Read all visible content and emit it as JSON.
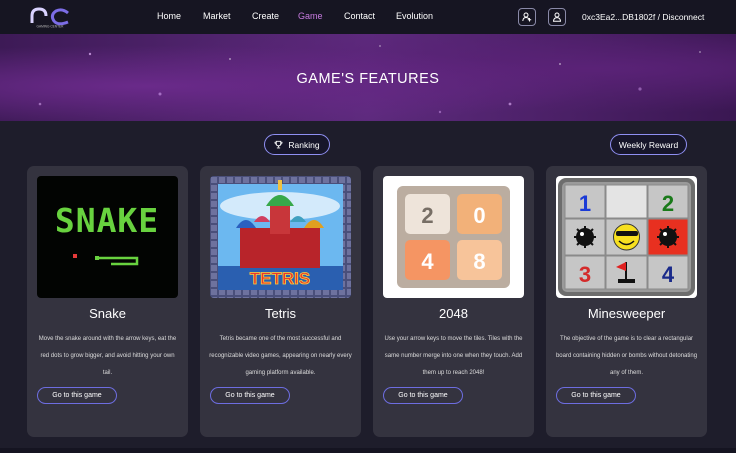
{
  "nav": {
    "logo_text": "GAMING CENTER",
    "links": [
      {
        "label": "Home",
        "active": false
      },
      {
        "label": "Market",
        "active": false
      },
      {
        "label": "Create",
        "active": false
      },
      {
        "label": "Game",
        "active": true
      },
      {
        "label": "Contact",
        "active": false
      },
      {
        "label": "Evolution",
        "active": false
      }
    ],
    "icons": [
      "user-add-icon",
      "user-icon"
    ],
    "wallet_text": "0xc3Ea2...DB1802f / Disconnect"
  },
  "hero": {
    "title": "GAME'S FEATURES"
  },
  "controls": {
    "ranking_label": "Ranking",
    "ranking_icon": "trophy-icon",
    "weekly_label": "Weekly Reward"
  },
  "games": [
    {
      "title": "Snake",
      "description": "Move the snake around with the arrow keys, eat the red dots to grow bigger, and avoid hitting your own tail.",
      "button": "Go to this game",
      "thumb_text": "SNAKE"
    },
    {
      "title": "Tetris",
      "description": "Tetris became one of the most successful and recognizable video games, appearing on nearly every gaming platform available.",
      "button": "Go to this game",
      "thumb_text": "TETRIS"
    },
    {
      "title": "2048",
      "description": "Use your arrow keys to move the tiles. Tiles with the same number merge into one when they touch. Add them up to reach 2048!",
      "button": "Go to this game",
      "tiles": [
        "2",
        "0",
        "4",
        "8"
      ]
    },
    {
      "title": "Minesweeper",
      "description": "The objective of the game is to clear a rectangular board containing hidden or bombs without detonating any of them.",
      "button": "Go to this game",
      "cells": [
        "1",
        "",
        "2",
        "",
        "",
        "",
        "3",
        "",
        "4"
      ]
    }
  ],
  "colors": {
    "background": "#1e1d2b",
    "card": "#34333f",
    "accent": "#8f8ff2",
    "active_nav": "#c77be0"
  }
}
